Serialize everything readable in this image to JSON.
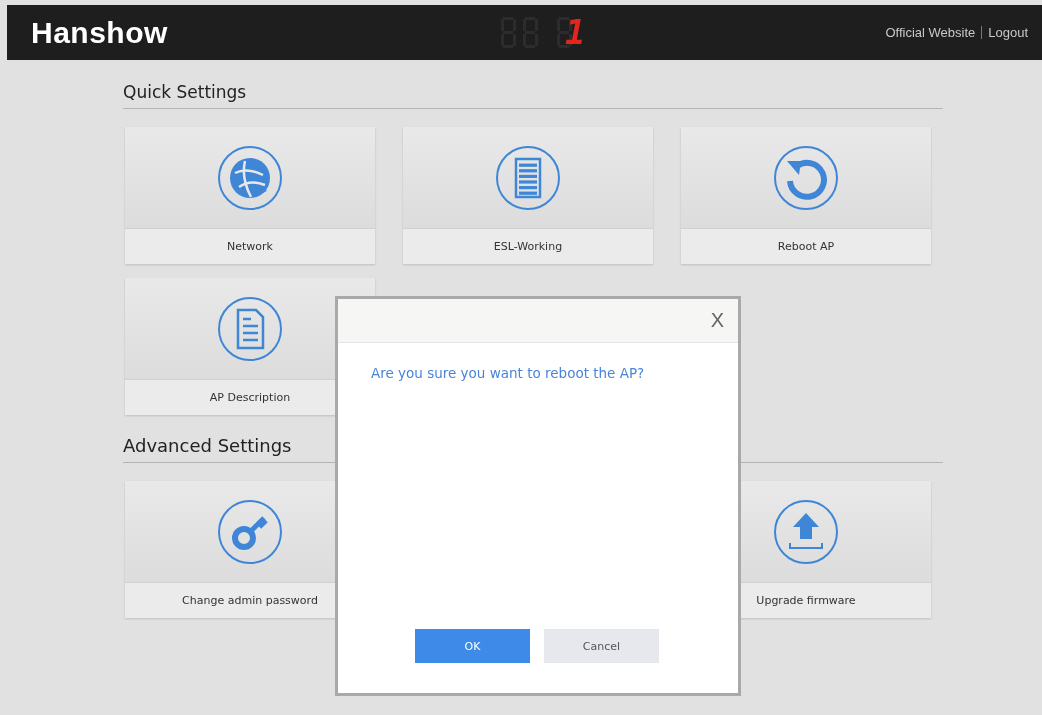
{
  "header": {
    "logo": "Hanshow",
    "counter": "1",
    "links": [
      "Official Website",
      "Logout"
    ]
  },
  "sections": [
    {
      "title": "Quick Settings",
      "cards": [
        {
          "kind": "globe",
          "label": "Network"
        },
        {
          "kind": "rack",
          "label": "ESL-Working"
        },
        {
          "kind": "reboot",
          "label": "Reboot AP"
        },
        {
          "kind": "document",
          "label": "AP Description"
        }
      ]
    },
    {
      "title": "Advanced Settings",
      "cards": [
        {
          "kind": "key",
          "label": "Change admin password"
        },
        {
          "kind": "upload",
          "label": "Upgrade firmware"
        }
      ]
    }
  ],
  "dialog": {
    "close": "X",
    "message": "Are you sure you want to reboot the AP?",
    "buttons": [
      {
        "label": "OK",
        "primary": true
      },
      {
        "label": "Cancel",
        "primary": false
      }
    ]
  }
}
